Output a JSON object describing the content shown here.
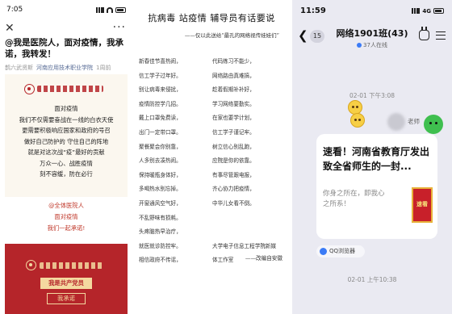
{
  "left": {
    "status_time": "7:05",
    "title": "@我是医院人，面对疫情，我承诺，我转发！",
    "meta_prefix": "鹊六武贤斯",
    "account": "河南应用技术职业学院",
    "meta_suffix": "1周前",
    "poem": [
      "面对疫情",
      "我们不仅需要奋战在一线的白衣天使",
      "更需要积极响应国家和政府的号召",
      "做好自己防护的 守住自己的阵地",
      "就是对这次战“疫”最好的贡献",
      "万众一心、战胜疫情",
      "刻不容缓，防在必行"
    ],
    "rally": [
      "@全体医院人",
      "面对疫情",
      "我们一起承诺!"
    ],
    "badge_primary": "我是共产党员",
    "badge_secondary": "我承诺"
  },
  "middle": {
    "headline": "抗病毒  站疫情  辅导员有话要说",
    "byline": "——仅以此送给“最孔的网络视传娃娃们”",
    "col_left": [
      "新春佳节喜热闹，",
      "信工学子过年好。",
      "别让病毒来侵扰，",
      "疫情防控学几招。",
      "戴上口罩免费读，",
      "出门一定带口罩。",
      "聚餐聚会你别靠，",
      "人多别去凑热闹。",
      "保持暖瓶身体好，",
      "多喝热水别忘掉。",
      "开窗通风空气好，",
      "不乱野味有损耗。",
      "头疼脑热早治疗，",
      "就医就诊防控牢。",
      "相信政府不传谣，"
    ],
    "col_right": [
      "代码练习不能少，",
      "网络路由真难搞，",
      "趁着假期补补好，",
      "学习网络要勤实。",
      "在家也要学计划，",
      "信工学子谨记牢。",
      "树立信心别乱跑，",
      "应院是你的依靠。",
      "有事尽管跟电报，",
      "齐心协力把疫情，",
      "中华儿女看不倒。"
    ],
    "sign_line": "——改编自安徽",
    "col_right_tail": [
      "大学电子信息工程学院新媒",
      "体工作室"
    ]
  },
  "right": {
    "status_time": "11:59",
    "network": "4G",
    "unread_count": "15",
    "group_name": "网络1901班(43)",
    "online": "37人在线",
    "timestamp1": "02-01 下午3:08",
    "sender": "老师",
    "card_title": "速看！河南省教育厅发出致全省师生的一封...",
    "card_desc": "你身之所在，即我心之所系！",
    "thumb_text": "速看",
    "source": "QQ浏览器",
    "timestamp2": "02-01 上午10:38"
  }
}
